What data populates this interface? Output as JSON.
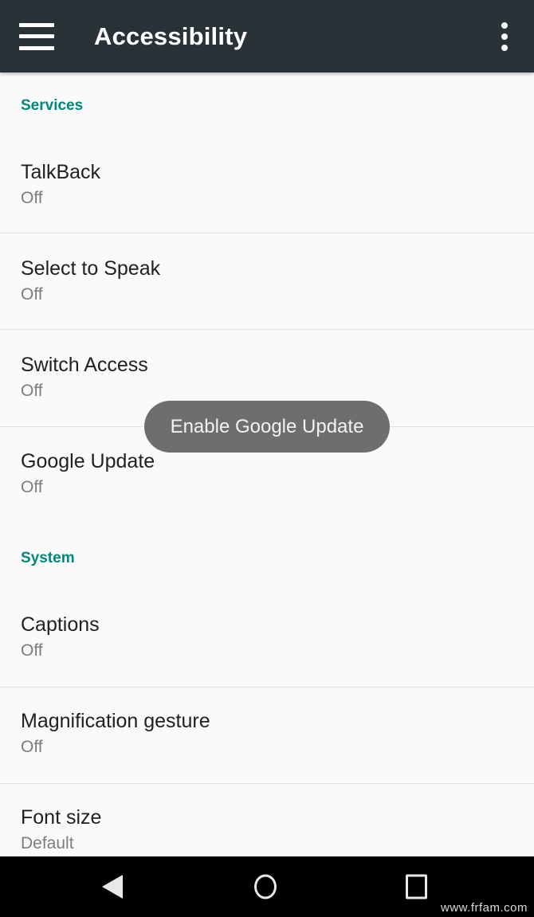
{
  "appbar": {
    "title": "Accessibility",
    "menu_icon": "hamburger-menu-icon",
    "overflow_icon": "more-vertical-icon",
    "background_color": "#283237",
    "title_color": "#ffffff"
  },
  "theme": {
    "accent_color": "#00897b",
    "page_background": "#fafafa",
    "primary_text_color": "#212121",
    "secondary_text_color": "#7c7c7c",
    "divider_color": "#e4e4e4"
  },
  "sections": [
    {
      "header": "Services",
      "rows": [
        {
          "title": "TalkBack",
          "value": "Off"
        },
        {
          "title": "Select to Speak",
          "value": "Off"
        },
        {
          "title": "Switch Access",
          "value": "Off"
        },
        {
          "title": "Google Update",
          "value": "Off"
        }
      ]
    },
    {
      "header": "System",
      "rows": [
        {
          "title": "Captions",
          "value": "Off"
        },
        {
          "title": "Magnification gesture",
          "value": "Off"
        },
        {
          "title": "Font size",
          "value": "Default"
        }
      ]
    }
  ],
  "toast": {
    "message": "Enable Google Update",
    "background_color": "#6e6e6e",
    "text_color": "#f2f2f2"
  },
  "navbar": {
    "background_color": "#000000",
    "back_icon": "triangle-back-icon",
    "home_icon": "circle-home-icon",
    "recents_icon": "square-recents-icon",
    "watermark": "www.frfam.com"
  }
}
